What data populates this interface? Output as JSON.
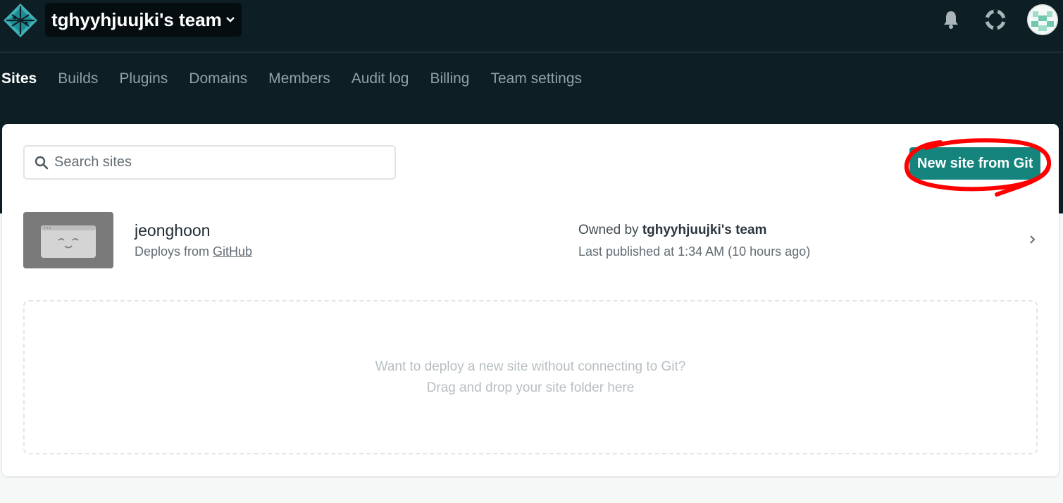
{
  "header": {
    "team_name": "tghyyhjuujki's team",
    "icons": [
      "netlify-logo-icon",
      "chevron-down-icon",
      "bell-icon",
      "lifebuoy-help-icon",
      "avatar"
    ]
  },
  "nav": {
    "tabs": [
      {
        "label": "Sites",
        "active": true
      },
      {
        "label": "Builds",
        "active": false
      },
      {
        "label": "Plugins",
        "active": false
      },
      {
        "label": "Domains",
        "active": false
      },
      {
        "label": "Members",
        "active": false
      },
      {
        "label": "Audit log",
        "active": false
      },
      {
        "label": "Billing",
        "active": false
      },
      {
        "label": "Team settings",
        "active": false
      }
    ]
  },
  "search": {
    "placeholder": "Search sites",
    "value": ""
  },
  "toolbar": {
    "new_site_label": "New site from Git"
  },
  "sites": [
    {
      "name": "jeonghoon",
      "deploy_prefix": "Deploys from ",
      "deploy_source": "GitHub",
      "owner_prefix": "Owned by ",
      "owner": "tghyyhjuujki's team",
      "published": "Last published at 1:34 AM (10 hours ago)"
    }
  ],
  "dropzone": {
    "line1": "Want to deploy a new site without connecting to Git?",
    "line2": "Drag and drop your site folder here"
  },
  "colors": {
    "topbar_bg": "#0e1e25",
    "accent_button": "#15847d",
    "annotation_red": "#ff0000"
  }
}
